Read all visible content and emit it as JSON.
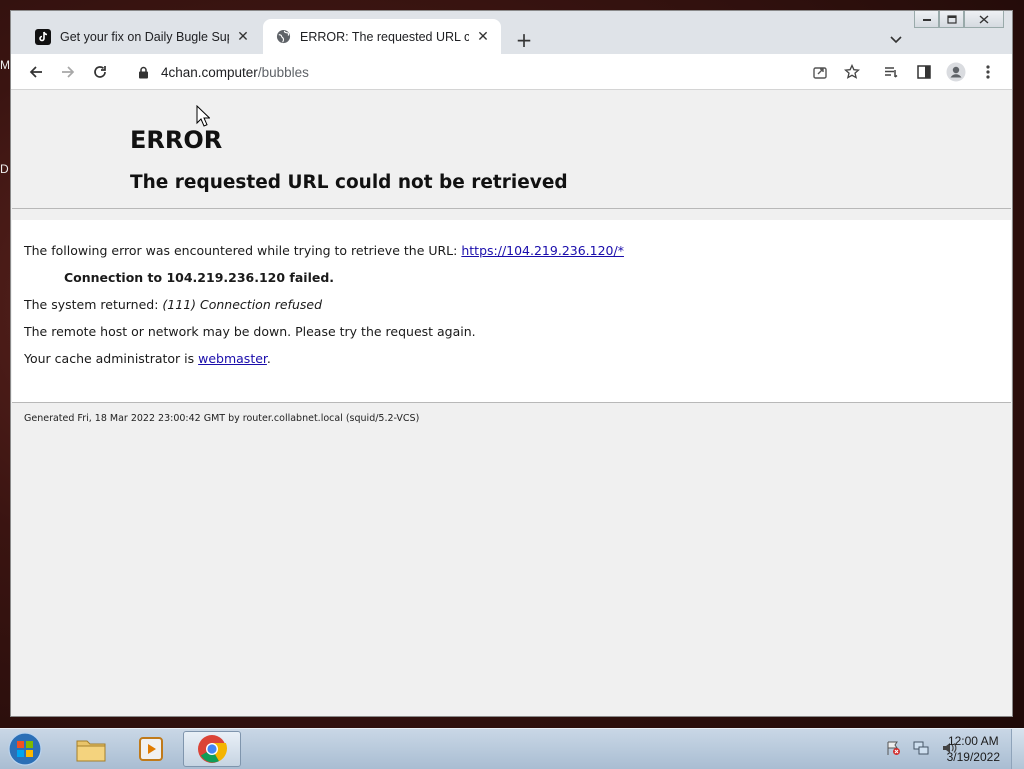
{
  "desktop": {
    "edge_text_top": "M",
    "edge_text_mid": "D"
  },
  "browser": {
    "tabs": [
      {
        "title": "Get your fix on Daily Bugle Supp",
        "favicon": "tiktok-icon",
        "active": false
      },
      {
        "title": "ERROR: The requested URL could",
        "favicon": "globe-icon",
        "active": true
      }
    ],
    "new_tab_label": "+",
    "address": {
      "host": "4chan.computer",
      "path": "/bubbles"
    }
  },
  "page": {
    "heading": "ERROR",
    "subheading": "The requested URL could not be retrieved",
    "line1_text": "The following error was encountered while trying to retrieve the URL: ",
    "line1_link": "https://104.219.236.120/*",
    "connection_failed": "Connection to 104.219.236.120 failed.",
    "system_returned_label": "The system returned: ",
    "system_returned_value": "(111) Connection refused",
    "remote_host_msg": "The remote host or network may be down. Please try the request again.",
    "cache_admin_text": "Your cache administrator is ",
    "cache_admin_link": "webmaster",
    "cache_admin_suffix": ".",
    "generated": "Generated Fri, 18 Mar 2022 23:00:42 GMT by router.collabnet.local (squid/5.2-VCS)"
  },
  "taskbar": {
    "clock_time": "12:00 AM",
    "clock_date": "3/19/2022",
    "apps": [
      "file-explorer-icon",
      "media-player-icon",
      "chrome-icon"
    ]
  }
}
